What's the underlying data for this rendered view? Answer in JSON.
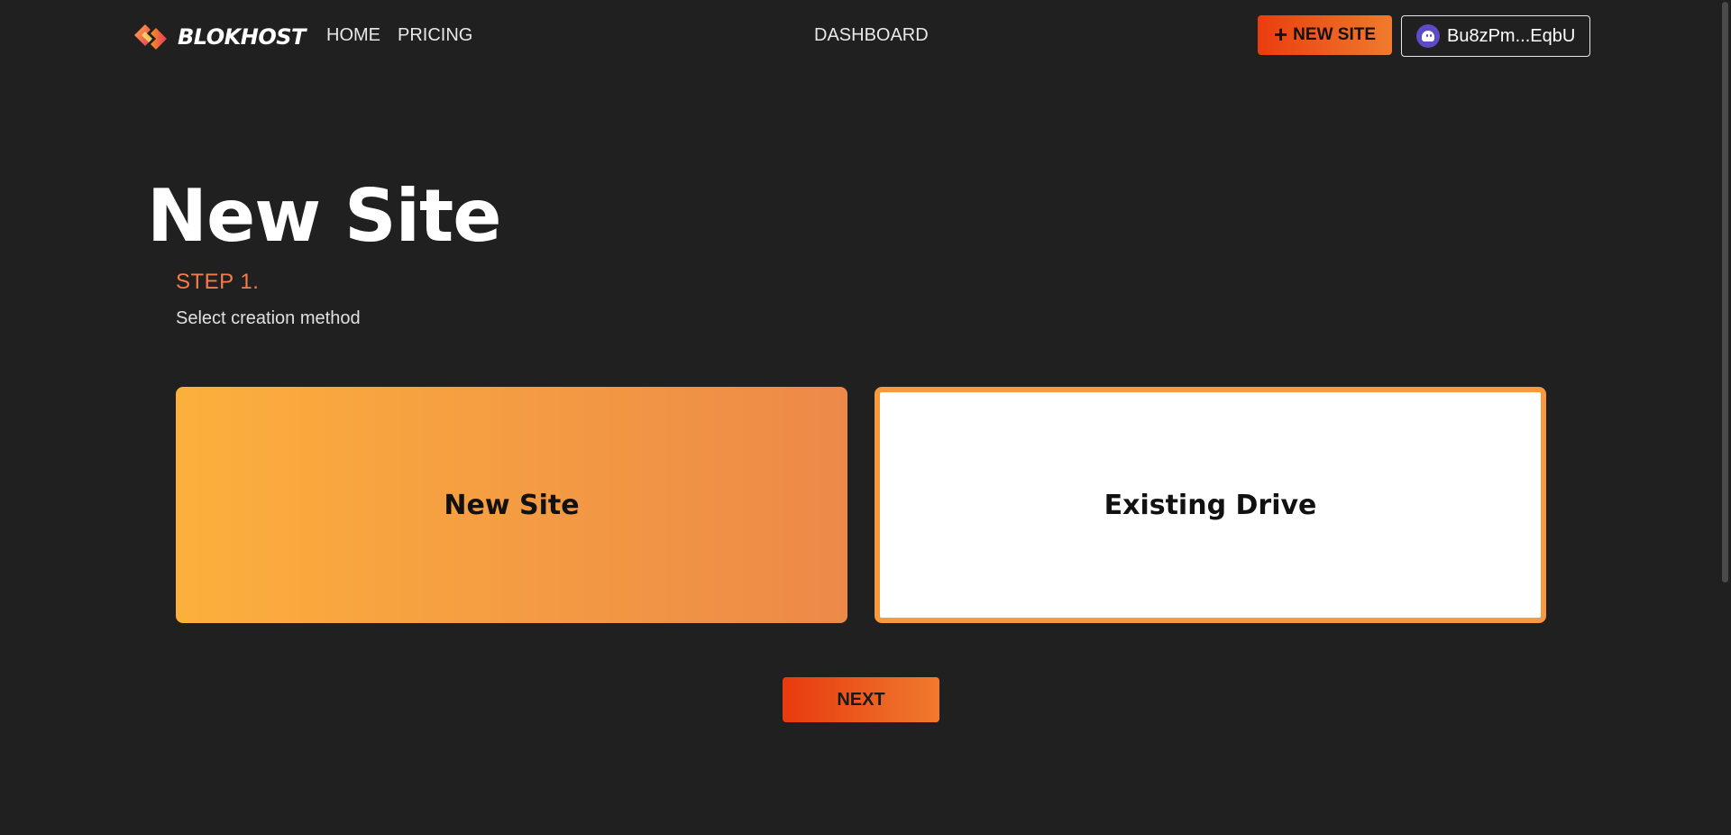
{
  "header": {
    "brand_name": "BLOKHOST",
    "nav": {
      "home": "HOME",
      "pricing": "PRICING",
      "dashboard": "DASHBOARD"
    },
    "new_site_button": {
      "icon": "plus-icon",
      "label": "NEW SITE"
    },
    "wallet_button": {
      "icon": "phantom-ghost-icon",
      "address": "Bu8zPm...EqbU"
    }
  },
  "main": {
    "title": "New Site",
    "step_label": "STEP 1.",
    "step_description": "Select creation method",
    "options": [
      {
        "label": "New Site",
        "selected": true
      },
      {
        "label": "Existing Drive",
        "selected": false
      }
    ],
    "next_button": "NEXT"
  },
  "colors": {
    "background": "#202020",
    "accent_start": "#ea3d0f",
    "accent_end": "#f07a2c",
    "step_label": "#f47c4a",
    "card_gradient_start": "#fcb03c",
    "card_gradient_end": "#ed8948"
  }
}
